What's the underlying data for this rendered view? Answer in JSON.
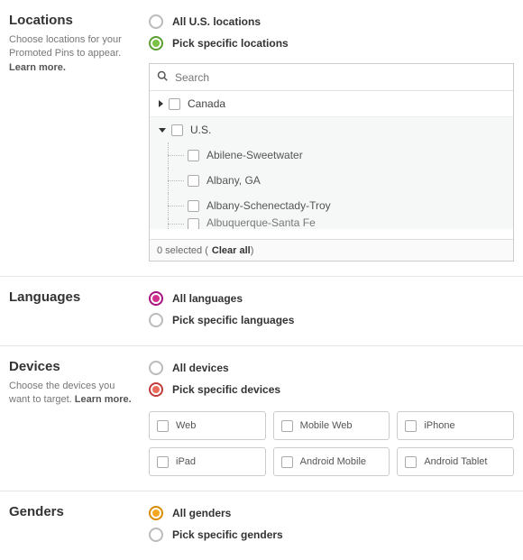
{
  "locations": {
    "title": "Locations",
    "desc_pre": "Choose locations for your Promoted Pins to appear. ",
    "desc_link": "Learn more.",
    "opt_all": "All U.S. locations",
    "opt_pick": "Pick specific locations",
    "search_placeholder": "Search",
    "tree": {
      "canada": "Canada",
      "us": "U.S.",
      "children": [
        "Abilene-Sweetwater",
        "Albany, GA",
        "Albany-Schenectady-Troy",
        "Albuquerque-Santa Fe"
      ]
    },
    "status_count": "0 selected",
    "status_clear": "Clear all"
  },
  "languages": {
    "title": "Languages",
    "opt_all": "All languages",
    "opt_pick": "Pick specific languages"
  },
  "devices": {
    "title": "Devices",
    "desc_pre": "Choose the devices you want to target. ",
    "desc_link": "Learn more.",
    "opt_all": "All devices",
    "opt_pick": "Pick specific devices",
    "options": [
      "Web",
      "Mobile Web",
      "iPhone",
      "iPad",
      "Android Mobile",
      "Android Tablet"
    ]
  },
  "genders": {
    "title": "Genders",
    "opt_all": "All genders",
    "opt_pick": "Pick specific genders"
  }
}
